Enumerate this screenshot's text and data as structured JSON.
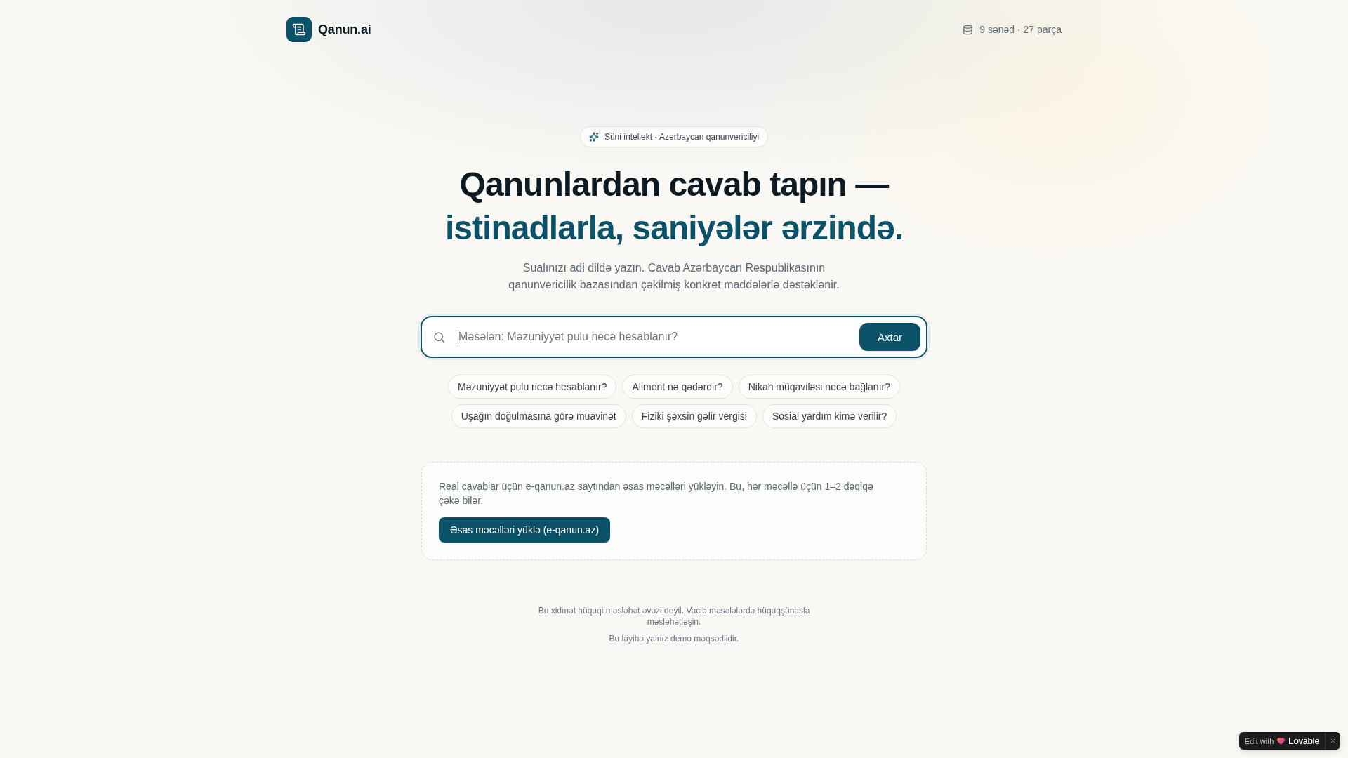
{
  "header": {
    "app_name": "Qanun.ai",
    "stats": "9 sənəd · 27 parça"
  },
  "hero": {
    "badge": "Süni intellekt · Azərbaycan qanunvericiliyi",
    "headline": "Qanunlardan cavab tapın —",
    "headline_highlight": "istinadlarla, saniyələr ərzində.",
    "subtitle": "Sualınızı adi dildə yazın. Cavab Azərbaycan Respublikasının qanunvericilik bazasından çəkilmiş konkret maddələrlə dəstəklənir."
  },
  "search": {
    "placeholder": "Məsələn: Məzuniyyət pulu necə hesablanır?",
    "focused": true,
    "button": "Axtar"
  },
  "suggestions": [
    "Məzuniyyət pulu necə hesablanır?",
    "Aliment nə qədərdir?",
    "Nikah müqaviləsi necə bağlanır?",
    "Uşağın doğulmasına görə müavinət",
    "Fiziki şəxsin gəlir vergisi",
    "Sosial yardım kimə verilir?"
  ],
  "notice": {
    "text": "Real cavablar üçün e-qanun.az saytından əsas məcəlləri yükləyin. Bu, hər məcəllə üçün 1–2 dəqiqə çəkə bilər.",
    "button": "Əsas məcəlləri yüklə (e-qanun.az)"
  },
  "footer": {
    "disclaimer": "Bu xidmət hüquqi məsləhət əvəzi deyil. Vacib məsələlərdə hüquqşünasla məsləhətləşin.",
    "note": "Bu layihə yalnız demo məqsədlidir."
  },
  "edit_badge": {
    "label": "Edit with",
    "brand": "Lovable"
  }
}
